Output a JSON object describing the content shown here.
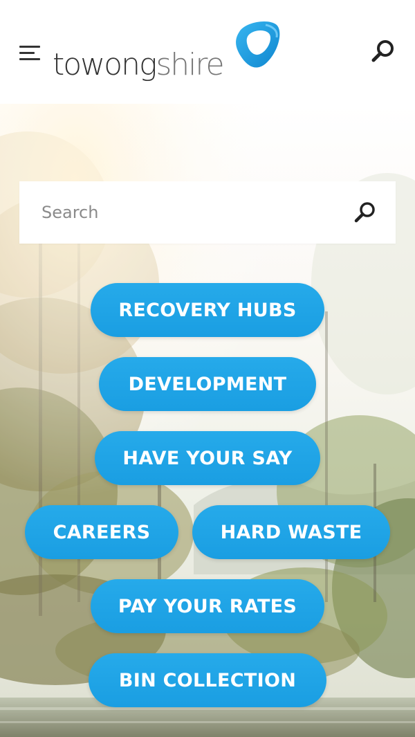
{
  "header": {
    "logo": {
      "part1": "towong",
      "part2": "shire"
    }
  },
  "search": {
    "placeholder": "Search"
  },
  "quick_links": [
    "RECOVERY HUBS",
    "DEVELOPMENT",
    "HAVE YOUR SAY",
    "CAREERS",
    "HARD WASTE",
    "PAY YOUR RATES",
    "BIN COLLECTION"
  ],
  "colors": {
    "accent": "#1fa3e6",
    "pill_text": "#ffffff",
    "logo_text": "#333333",
    "logo_mark": "#1796d8"
  },
  "icons": {
    "menu": "hamburger-icon",
    "search": "magnifier-icon",
    "logo_mark": "droplet-ring-icon"
  }
}
